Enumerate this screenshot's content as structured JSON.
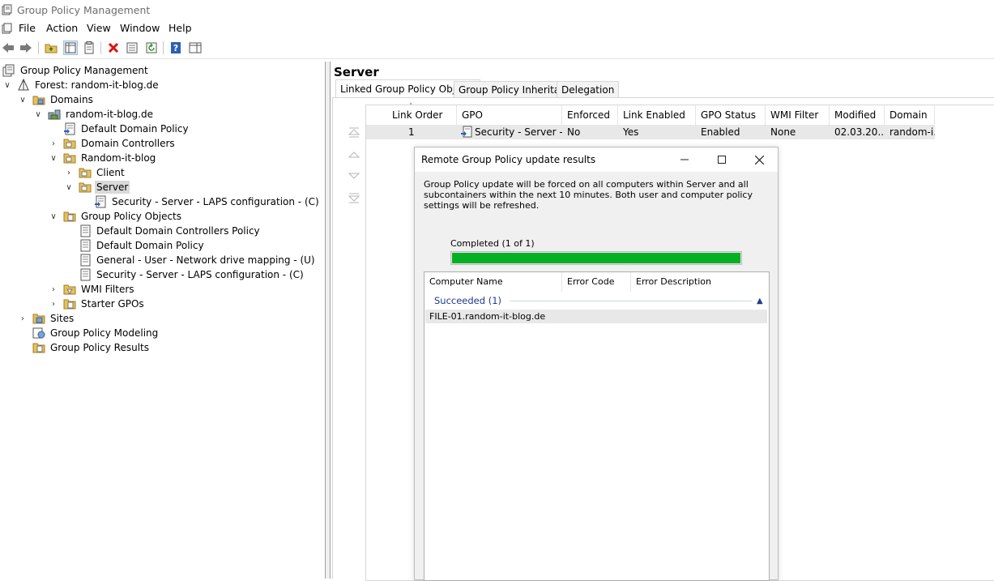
{
  "window": {
    "title": "Group Policy Management"
  },
  "menu": [
    "File",
    "Action",
    "View",
    "Window",
    "Help"
  ],
  "toolbar": {
    "buttons": [
      "back-icon",
      "forward-icon",
      "up-folder-icon",
      "show-hide-console-tree-icon",
      "properties-list-icon",
      "delete-icon",
      "properties-icon",
      "refresh-icon",
      "help-icon",
      "show-hide-action-pane-icon"
    ]
  },
  "tree": {
    "root": "Group Policy Management",
    "forest": "Forest: random-it-blog.de",
    "domains": "Domains",
    "domain": "random-it-blog.de",
    "default_domain_policy": "Default Domain Policy",
    "domain_controllers": "Domain Controllers",
    "random_it_blog": "Random-it-blog",
    "client": "Client",
    "server": "Server",
    "server_link": "Security - Server - LAPS configuration - (C)",
    "gpo_folder": "Group Policy Objects",
    "gpo_items": [
      "Default Domain Controllers Policy",
      "Default Domain Policy",
      "General - User - Network drive mapping - (U)",
      "Security - Server - LAPS configuration - (C)"
    ],
    "wmi_filters": "WMI Filters",
    "starter_gpos": "Starter GPOs",
    "sites": "Sites",
    "modeling": "Group Policy Modeling",
    "results": "Group Policy Results"
  },
  "right": {
    "title": "Server",
    "tabs": [
      "Linked Group Policy Objects",
      "Group Policy Inheritance",
      "Delegation"
    ],
    "columns": [
      "Link Order",
      "GPO",
      "Enforced",
      "Link Enabled",
      "GPO Status",
      "WMI Filter",
      "Modified",
      "Domain"
    ],
    "row": {
      "link_order": "1",
      "gpo": "Security - Server - L...",
      "enforced": "No",
      "link_enabled": "Yes",
      "gpo_status": "Enabled",
      "wmi_filter": "None",
      "modified": "02.03.20...",
      "domain": "random-i..."
    }
  },
  "dialog": {
    "title": "Remote Group Policy update results",
    "message": "Group Policy update will be forced on all computers within Server and all subcontainers within the next 10 minutes. Both user and computer policy settings will be refreshed.",
    "progress_label": "Completed (1 of 1)",
    "progress_fraction": 1.0,
    "progress_color": "#06b025",
    "columns": [
      "Computer Name",
      "Error Code",
      "Error Description"
    ],
    "group_label": "Succeeded (1)",
    "result_row": "FILE-01.random-it-blog.de"
  }
}
